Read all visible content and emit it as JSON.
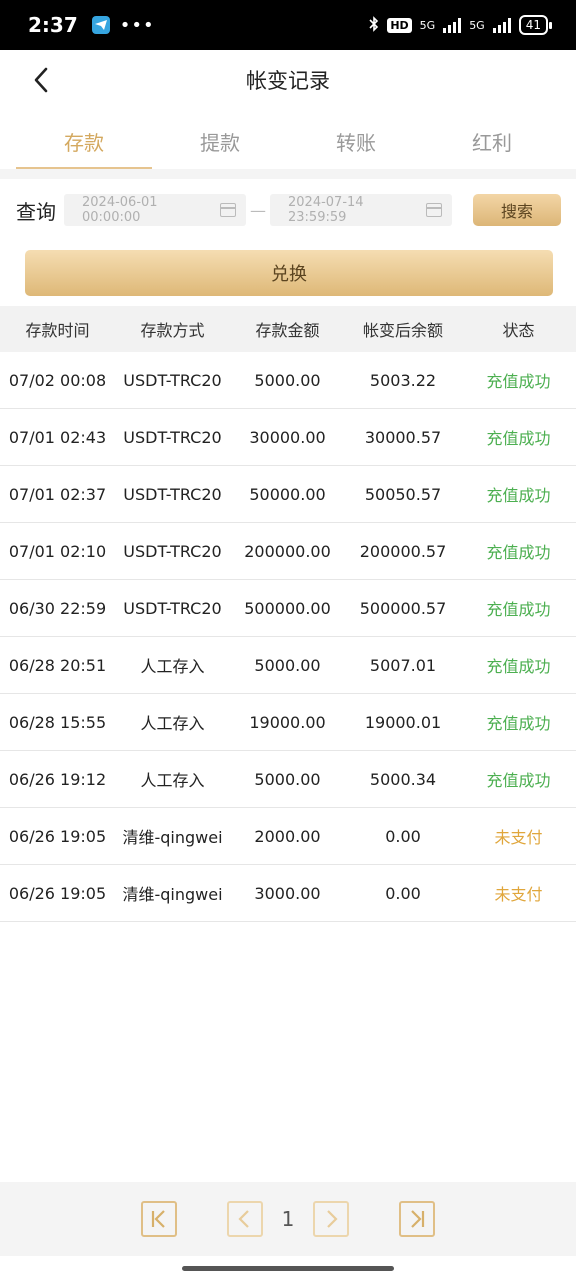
{
  "status_bar": {
    "time": "2:37",
    "dots": "•••",
    "net1": "5G",
    "net2": "5G",
    "hd": "HD",
    "battery": "41"
  },
  "header": {
    "title": "帐变记录"
  },
  "tabs": [
    {
      "label": "存款",
      "active": true
    },
    {
      "label": "提款",
      "active": false
    },
    {
      "label": "转账",
      "active": false
    },
    {
      "label": "红利",
      "active": false
    }
  ],
  "filter": {
    "label": "查询",
    "start": "2024-06-01 00:00:00",
    "end": "2024-07-14 23:59:59",
    "separator": "—",
    "search_label": "搜索"
  },
  "exchange_label": "兑换",
  "table": {
    "headers": [
      "存款时间",
      "存款方式",
      "存款金额",
      "帐变后余额",
      "状态"
    ],
    "rows": [
      [
        "07/02 00:08",
        "USDT-TRC20",
        "5000.00",
        "5003.22",
        "充值成功"
      ],
      [
        "07/01 02:43",
        "USDT-TRC20",
        "30000.00",
        "30000.57",
        "充值成功"
      ],
      [
        "07/01 02:37",
        "USDT-TRC20",
        "50000.00",
        "50050.57",
        "充值成功"
      ],
      [
        "07/01 02:10",
        "USDT-TRC20",
        "200000.00",
        "200000.57",
        "充值成功"
      ],
      [
        "06/30 22:59",
        "USDT-TRC20",
        "500000.00",
        "500000.57",
        "充值成功"
      ],
      [
        "06/28 20:51",
        "人工存入",
        "5000.00",
        "5007.01",
        "充值成功"
      ],
      [
        "06/28 15:55",
        "人工存入",
        "19000.00",
        "19000.01",
        "充值成功"
      ],
      [
        "06/26 19:12",
        "人工存入",
        "5000.00",
        "5000.34",
        "充值成功"
      ],
      [
        "06/26 19:05",
        "清维-qingwei",
        "2000.00",
        "0.00",
        "未支付"
      ],
      [
        "06/26 19:05",
        "清维-qingwei",
        "3000.00",
        "0.00",
        "未支付"
      ]
    ]
  },
  "pager": {
    "current_page": "1"
  },
  "colors": {
    "accent": "#d4a960",
    "success": "#4caf50",
    "unpaid": "#e0a63b"
  }
}
